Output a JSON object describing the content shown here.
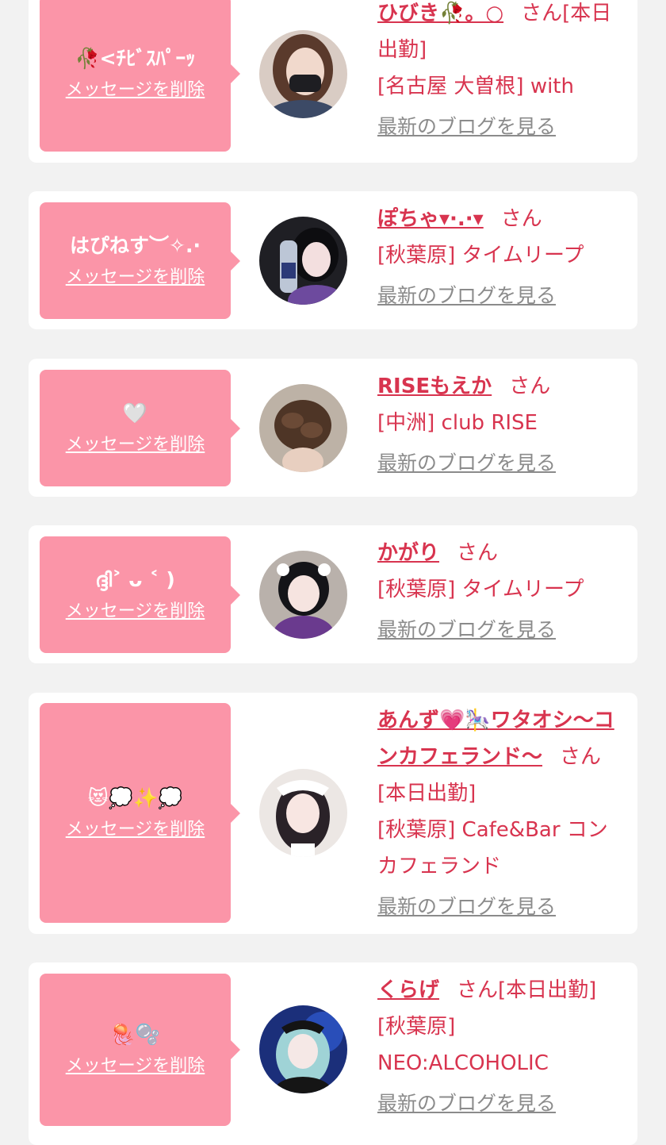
{
  "common": {
    "delete_label": "メッセージを削除",
    "san_label": "さん",
    "blog_label": "最新のブログを見る"
  },
  "cards": [
    {
      "message": "🥀<ﾁﾋﾞｽﾊﾟｰｯ",
      "name": "ひびき🥀。○",
      "status": "[本日出勤]",
      "shop": "[名古屋 大曽根] with"
    },
    {
      "message": "はぴねす︶✧.·",
      "name": "ぽちゃ▾·.·▾",
      "status": "",
      "shop": "[秋葉原] タイムリープ"
    },
    {
      "message": "🤍",
      "name": "RISEもえか",
      "status": "",
      "shop": "[中洲] club RISE"
    },
    {
      "message": "ദ്ദി˃ ᴗ ˂ )",
      "name": "かがり",
      "status": "",
      "shop": "[秋葉原] タイムリープ"
    },
    {
      "message": "😻💭✨💭",
      "name": "あんず💗🎠ワタオシ〜コンカフェランド〜",
      "status": "[本日出勤]",
      "shop": "[秋葉原] Cafe&Bar コンカフェランド"
    },
    {
      "message": "🪼🫧",
      "name": "くらげ",
      "status": "[本日出勤]",
      "shop": "[秋葉原] NEO:ALCOHOLIC"
    }
  ]
}
